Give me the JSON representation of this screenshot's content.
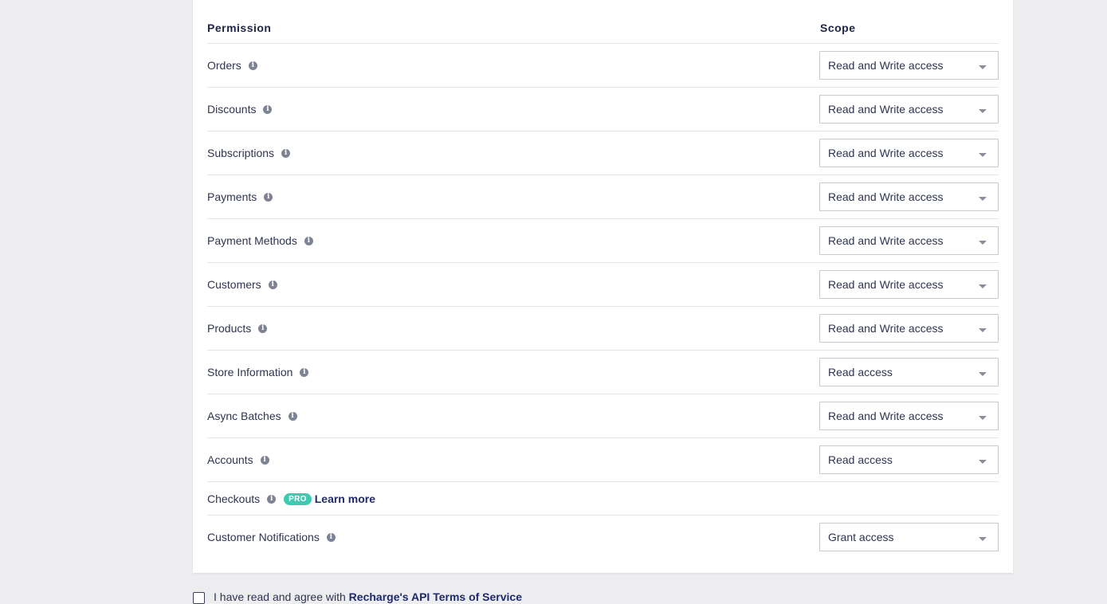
{
  "table": {
    "permission_header": "Permission",
    "scope_header": "Scope",
    "rows": [
      {
        "label": "Orders",
        "scope": "Read and Write access"
      },
      {
        "label": "Discounts",
        "scope": "Read and Write access"
      },
      {
        "label": "Subscriptions",
        "scope": "Read and Write access"
      },
      {
        "label": "Payments",
        "scope": "Read and Write access"
      },
      {
        "label": "Payment Methods",
        "scope": "Read and Write access"
      },
      {
        "label": "Customers",
        "scope": "Read and Write access"
      },
      {
        "label": "Products",
        "scope": "Read and Write access"
      },
      {
        "label": "Store Information",
        "scope": "Read access"
      },
      {
        "label": "Async Batches",
        "scope": "Read and Write access"
      },
      {
        "label": "Accounts",
        "scope": "Read access"
      }
    ],
    "checkouts": {
      "label": "Checkouts",
      "badge": "PRO",
      "learn_more": "Learn more"
    },
    "notifications": {
      "label": "Customer Notifications",
      "scope": "Grant access"
    }
  },
  "terms": {
    "text": "I have read and agree with ",
    "link": "Recharge's API Terms of Service"
  },
  "icons": {
    "info": "info-icon",
    "dropdown": "chevron-down-icon",
    "checkbox": "checkbox-icon"
  },
  "colors": {
    "page_background": "#ededef",
    "card_background": "#ffffff",
    "pro_badge": "#3ec9b0",
    "link": "#1f2a6b"
  }
}
